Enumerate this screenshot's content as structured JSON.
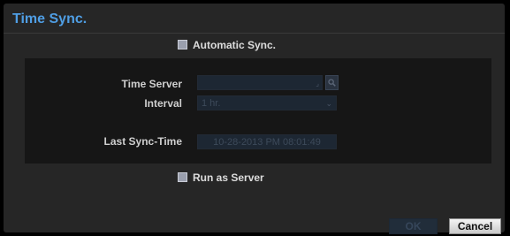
{
  "window": {
    "title": "Time Sync."
  },
  "auto_sync": {
    "label": "Automatic Sync.",
    "checked": true
  },
  "fields": {
    "time_server_label": "Time Server",
    "time_server_value": "",
    "interval_label": "Interval",
    "interval_value": "1 hr.",
    "last_sync_label": "Last Sync-Time",
    "last_sync_value": "10-28-2013  PM 08:01:49"
  },
  "run_as_server": {
    "label": "Run as Server",
    "checked": true
  },
  "buttons": {
    "ok_label": "OK",
    "cancel_label": "Cancel"
  },
  "colors": {
    "title": "#4f9ee4",
    "background": "#262626",
    "panel": "#161616",
    "disabled_field": "#1d2733"
  },
  "icons": {
    "search": "search-icon",
    "dropdown": "chevron-down-icon"
  }
}
